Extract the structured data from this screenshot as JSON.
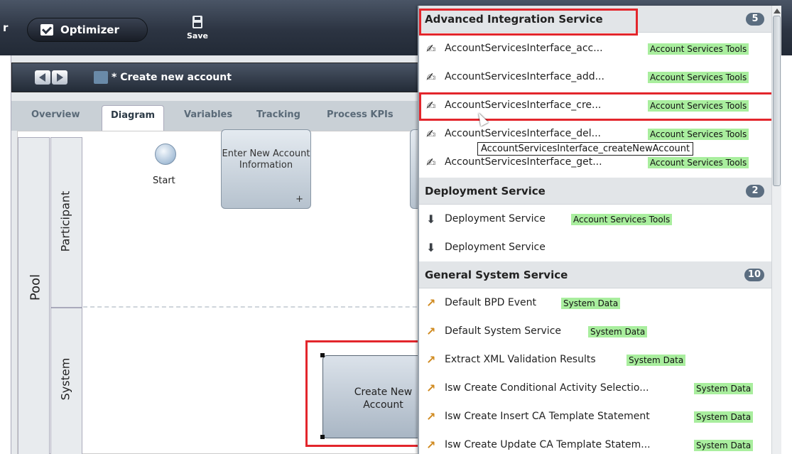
{
  "toolbar": {
    "left_fragment": "r",
    "optimizer_label": "Optimizer",
    "save_label": "Save"
  },
  "editor": {
    "process_name": "* Create new account",
    "tabs": [
      "Overview",
      "Diagram",
      "Variables",
      "Tracking",
      "Process KPIs"
    ]
  },
  "diagram": {
    "pool_label": "Pool",
    "lanes": [
      "Participant",
      "System"
    ],
    "start_label": "Start",
    "task_enter": "Enter New Account Information",
    "task_enter_marker": "+",
    "task_create": "Create New Account"
  },
  "library": {
    "sections": [
      {
        "title": "Advanced Integration Service",
        "count": "5",
        "items": [
          {
            "label": "AccountServicesInterface_acc...",
            "tag": "Account Services Tools",
            "icon": "integration-service-icon"
          },
          {
            "label": "AccountServicesInterface_add...",
            "tag": "Account Services Tools",
            "icon": "integration-service-icon"
          },
          {
            "label": "AccountServicesInterface_cre...",
            "tag": "Account Services Tools",
            "icon": "integration-service-icon"
          },
          {
            "label": "AccountServicesInterface_del...",
            "tag": "Account Services Tools",
            "icon": "integration-service-icon"
          },
          {
            "label": "AccountServicesInterface_get...",
            "tag": "Account Services Tools",
            "icon": "integration-service-icon"
          }
        ]
      },
      {
        "title": "Deployment Service",
        "count": "2",
        "items": [
          {
            "label": "Deployment Service",
            "tag": "Account Services Tools",
            "icon": "deployment-service-icon"
          },
          {
            "label": "Deployment Service",
            "tag": "",
            "icon": "deployment-service-icon"
          }
        ]
      },
      {
        "title": "General System Service",
        "count": "10",
        "items": [
          {
            "label": "Default BPD Event",
            "tag": "System Data",
            "icon": "system-service-icon"
          },
          {
            "label": "Default System Service",
            "tag": "System Data",
            "icon": "system-service-icon"
          },
          {
            "label": "Extract XML Validation Results",
            "tag": "System Data",
            "icon": "system-service-icon"
          },
          {
            "label": "Isw Create Conditional Activity Selectio...",
            "tag": "System Data",
            "icon": "system-service-icon"
          },
          {
            "label": "Isw Create Insert CA Template Statement",
            "tag": "System Data",
            "icon": "system-service-icon"
          },
          {
            "label": "Isw Create Update CA Template Statem...",
            "tag": "System Data",
            "icon": "system-service-icon"
          }
        ]
      }
    ],
    "tooltip": "AccountServicesInterface_createNewAccount"
  },
  "colors": {
    "highlight_red": "#e3262c",
    "tag_green": "#a9ee9e",
    "toolbar_dark": "#2c3442"
  }
}
